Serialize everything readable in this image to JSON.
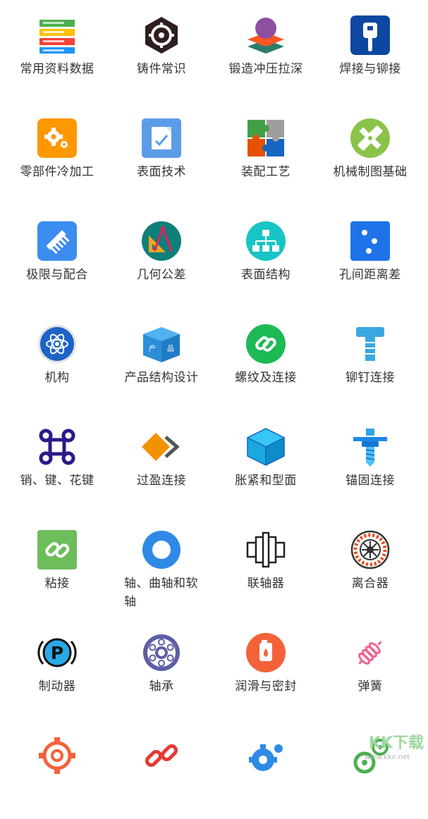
{
  "items": [
    {
      "label": "常用资料数据",
      "icon": "database-stack-icon"
    },
    {
      "label": "铸件常识",
      "icon": "gear-hexagon-icon"
    },
    {
      "label": "锻造冲压拉深",
      "icon": "layers-sphere-icon"
    },
    {
      "label": "焊接与铆接",
      "icon": "weld-tag-icon"
    },
    {
      "label": "零部件冷加工",
      "icon": "gears-icon"
    },
    {
      "label": "表面技术",
      "icon": "edit-document-icon"
    },
    {
      "label": "装配工艺",
      "icon": "puzzle-icon"
    },
    {
      "label": "机械制图基础",
      "icon": "ruler-pencil-icon"
    },
    {
      "label": "极限与配合",
      "icon": "comb-icon"
    },
    {
      "label": "几何公差",
      "icon": "drafting-tools-icon"
    },
    {
      "label": "表面结构",
      "icon": "hierarchy-icon"
    },
    {
      "label": "孔间距离差",
      "icon": "dots-icon"
    },
    {
      "label": "机构",
      "icon": "atom-icon"
    },
    {
      "label": "产品结构设计",
      "icon": "product-box-icon"
    },
    {
      "label": "螺纹及连接",
      "icon": "chain-link-icon"
    },
    {
      "label": "铆钉连接",
      "icon": "rivet-icon"
    },
    {
      "label": "销、键、花键",
      "icon": "command-key-icon"
    },
    {
      "label": "过盈连接",
      "icon": "interlock-icon"
    },
    {
      "label": "胀紧和型面",
      "icon": "cube-icon"
    },
    {
      "label": "锚固连接",
      "icon": "anchor-bolt-icon"
    },
    {
      "label": "粘接",
      "icon": "link-icon"
    },
    {
      "label": "轴、曲轴和软轴",
      "icon": "ring-icon"
    },
    {
      "label": "联轴器",
      "icon": "coupling-icon"
    },
    {
      "label": "离合器",
      "icon": "clutch-icon"
    },
    {
      "label": "制动器",
      "icon": "parking-brake-icon"
    },
    {
      "label": "轴承",
      "icon": "bearing-icon"
    },
    {
      "label": "润滑与密封",
      "icon": "oil-can-icon"
    },
    {
      "label": "弹簧",
      "icon": "spring-icon"
    },
    {
      "label": "",
      "icon": "gear-outline-icon"
    },
    {
      "label": "",
      "icon": "broken-chain-icon"
    },
    {
      "label": "",
      "icon": "gear-blue-icon"
    },
    {
      "label": "",
      "icon": "gear-green-icon"
    }
  ],
  "watermark": {
    "title": "KK下载",
    "url": "www.kkx.net"
  }
}
